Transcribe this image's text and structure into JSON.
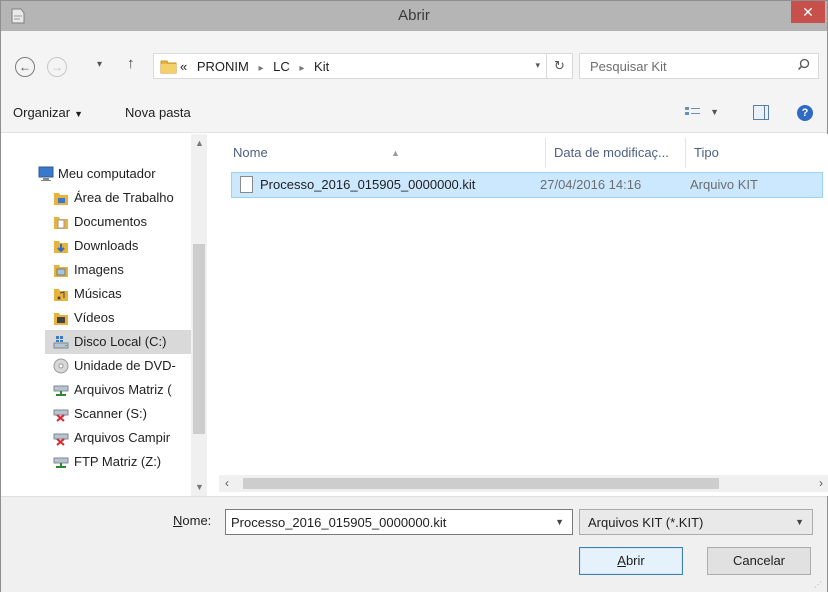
{
  "window": {
    "title": "Abrir",
    "close_glyph": "✕"
  },
  "address": {
    "back_glyph": "←",
    "forward_glyph": "→",
    "up_glyph": "↑",
    "crumb_prefix": "«",
    "crumbs": [
      "PRONIM",
      "LC",
      "Kit"
    ],
    "refresh_glyph": "↻"
  },
  "search": {
    "placeholder": "Pesquisar Kit"
  },
  "toolbar": {
    "organize_label": "Organizar",
    "new_folder_label": "Nova pasta"
  },
  "nav": {
    "root_label": "Meu computador",
    "items": [
      {
        "label": "Área de Trabalho",
        "icon": "desktop-folder-icon"
      },
      {
        "label": "Documentos",
        "icon": "documents-folder-icon"
      },
      {
        "label": "Downloads",
        "icon": "downloads-folder-icon"
      },
      {
        "label": "Imagens",
        "icon": "pictures-folder-icon"
      },
      {
        "label": "Músicas",
        "icon": "music-folder-icon"
      },
      {
        "label": "Vídeos",
        "icon": "videos-folder-icon"
      },
      {
        "label": "Disco Local (C:)",
        "icon": "local-disk-icon",
        "selected": true
      },
      {
        "label": "Unidade de DVD-",
        "icon": "dvd-drive-icon"
      },
      {
        "label": "Arquivos Matriz (",
        "icon": "network-drive-icon"
      },
      {
        "label": "Scanner (S:)",
        "icon": "disconnected-network-drive-icon"
      },
      {
        "label": "Arquivos Campir",
        "icon": "disconnected-network-drive-icon"
      },
      {
        "label": "FTP Matriz (Z:)",
        "icon": "network-drive-icon"
      }
    ]
  },
  "files": {
    "columns": {
      "name": "Nome",
      "modified": "Data de modificaç...",
      "type": "Tipo"
    },
    "rows": [
      {
        "name": "Processo_2016_015905_0000000.kit",
        "modified": "27/04/2016 14:16",
        "type": "Arquivo KIT",
        "selected": true
      }
    ]
  },
  "bottom": {
    "name_label_prefix": "N",
    "name_label_rest": "ome:",
    "filename_value": "Processo_2016_015905_0000000.kit",
    "filetype_value": "Arquivos KIT (*.KIT)",
    "open_label_prefix": "A",
    "open_label_rest": "brir",
    "cancel_label": "Cancelar"
  },
  "colors": {
    "titlebar": "#b5b5b5",
    "close": "#c7504a",
    "selection_fill": "#cce8ff",
    "selection_border": "#99d1ff",
    "nav_selected": "#d9d9d9",
    "folder": "#e8b33a"
  }
}
